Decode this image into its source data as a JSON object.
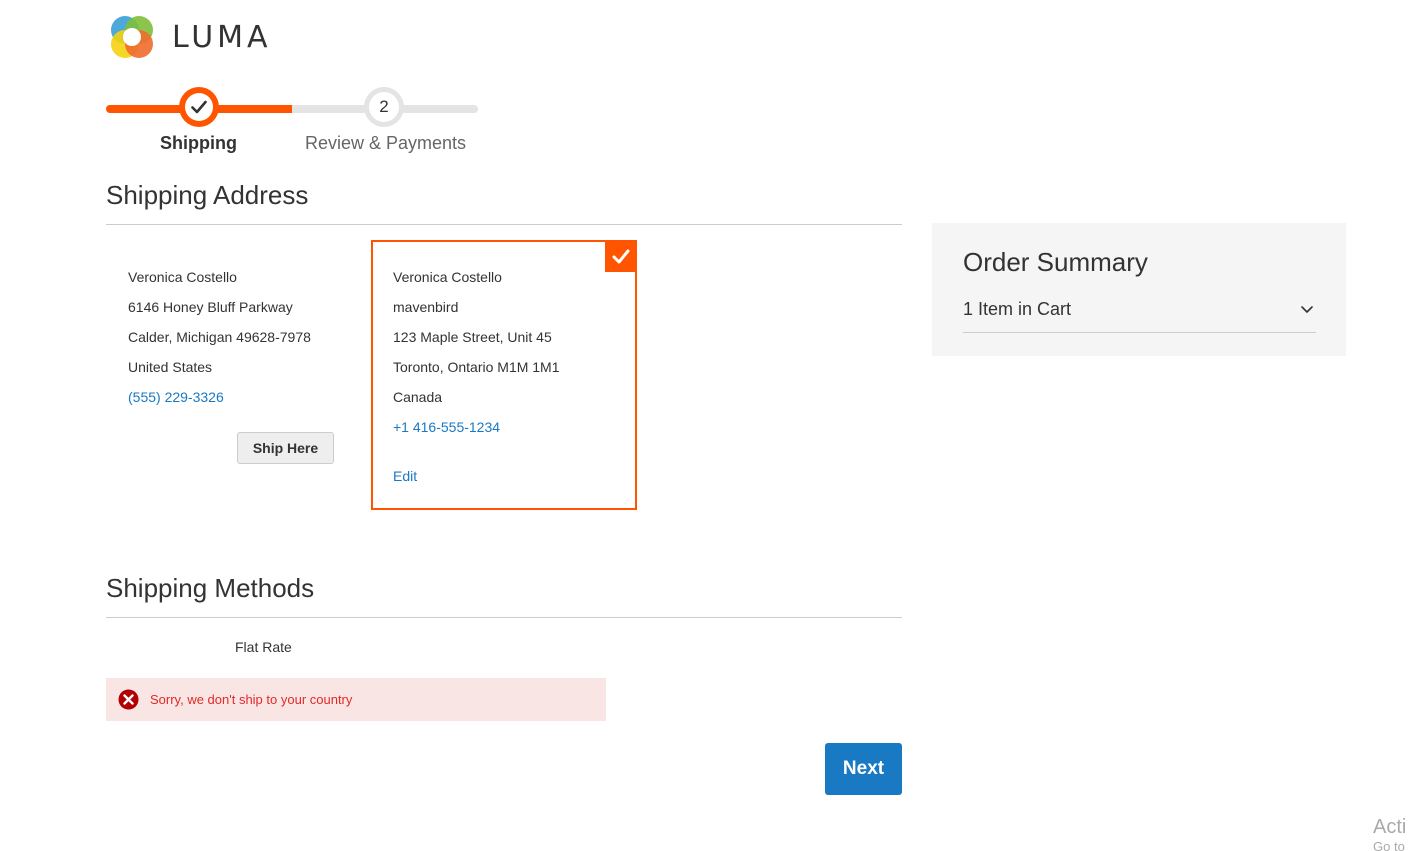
{
  "brand": {
    "name": "LUMA"
  },
  "progress": {
    "steps": [
      {
        "label": "Shipping",
        "state": "complete"
      },
      {
        "number": "2",
        "label": "Review & Payments",
        "state": "pending"
      }
    ]
  },
  "shipping_address": {
    "title": "Shipping Address",
    "addresses": [
      {
        "name": "Veronica Costello",
        "street": "6146 Honey Bluff Parkway",
        "city_line": "Calder, Michigan 49628-7978",
        "country": "United States",
        "phone": "(555) 229-3326",
        "button_label": "Ship Here",
        "selected": false
      },
      {
        "name": "Veronica Costello",
        "company": "mavenbird",
        "street": "123 Maple Street, Unit 45",
        "city_line": "Toronto, Ontario M1M 1M1",
        "country": "Canada",
        "phone": "+1 416-555-1234",
        "edit_label": "Edit",
        "selected": true
      }
    ]
  },
  "shipping_methods": {
    "title": "Shipping Methods",
    "method_label": "Flat Rate",
    "error_message": "Sorry, we don't ship to your country"
  },
  "next_button": "Next",
  "order_summary": {
    "title": "Order Summary",
    "items_label": "1 Item in Cart"
  },
  "watermark": {
    "line1": "Acti",
    "line2": "Go to"
  },
  "colors": {
    "accent": "#ff5501",
    "link": "#1979c3",
    "error_bg": "#fae5e5",
    "error_text": "#e02b27"
  }
}
